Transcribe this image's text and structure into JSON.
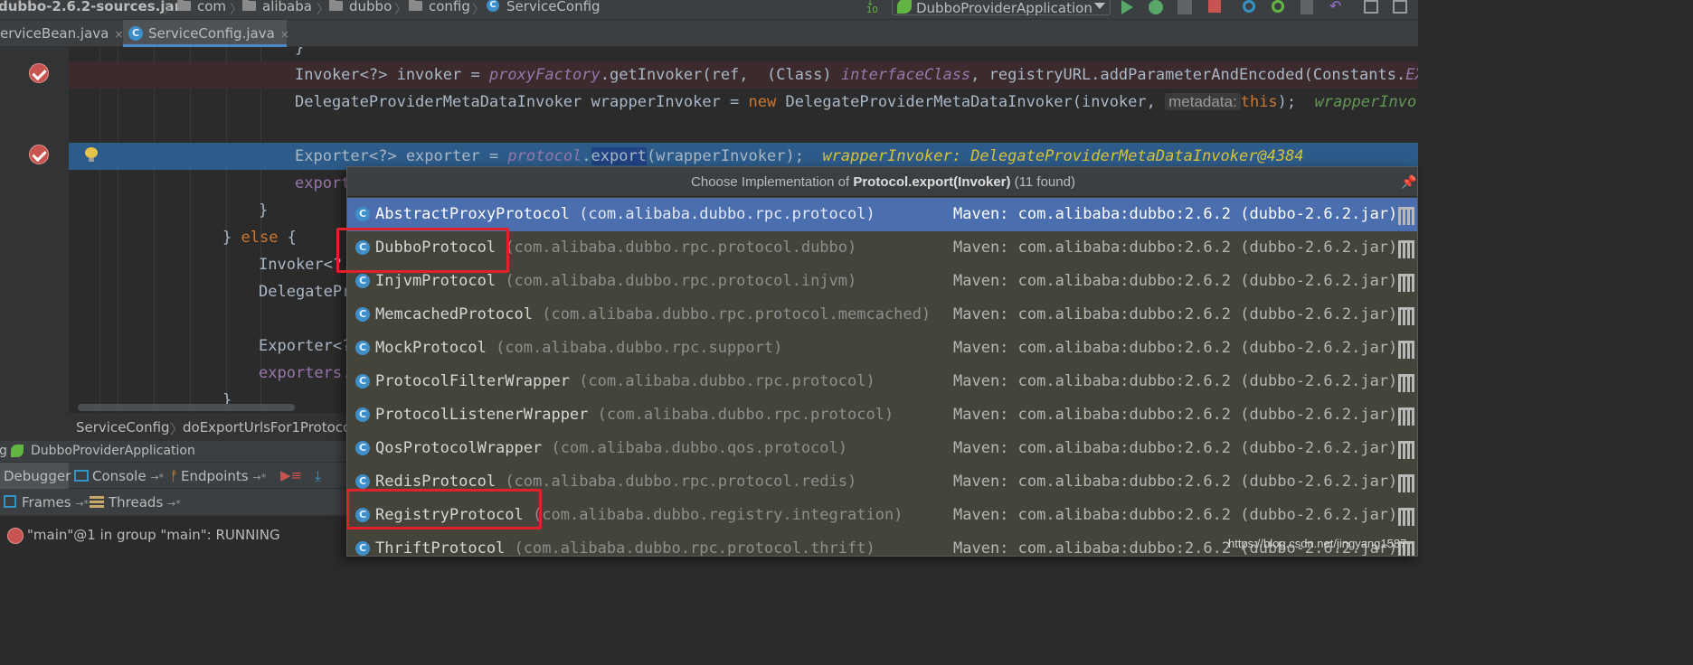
{
  "navbar": {
    "breadcrumbs": [
      "dubbo-2.6.2-sources.jar",
      "com",
      "alibaba",
      "dubbo",
      "config",
      "ServiceConfig"
    ],
    "run_config": "DubboProviderApplication"
  },
  "tabs": [
    {
      "label": "erviceBean.java",
      "close": "×"
    },
    {
      "label": "ServiceConfig.java",
      "close": "×"
    }
  ],
  "editor": {
    "line_top_fragment": "}",
    "line1": {
      "a": "Invoker<?> invoker = ",
      "b": "proxyFactory",
      "c": ".getInvoker(ref,  (Class) ",
      "d": "interfaceClass",
      "e": ", registryURL.addParameterAndEncoded(Constants.",
      "f": "EXPOR"
    },
    "line2": {
      "a": "DelegateProviderMetaDataInvoker wrapperInvoker = ",
      "kw": "new",
      "b": " DelegateProviderMetaDataInvoker(invoker, ",
      "param": "metadata:",
      "kw2": "this",
      "c": ");  ",
      "ghost": "wrapperInvo"
    },
    "line3": {
      "a": "Exporter<?> exporter = ",
      "b": "protocol",
      "dot": ".",
      "sel": "export",
      "c": "(wrapperInvoker);  ",
      "hint": "wrapperInvoker: DelegateProviderMetaDataInvoker@4384"
    },
    "line4": "export",
    "line5": "}",
    "line6": {
      "a": "} ",
      "kw": "else",
      "b": " {"
    },
    "line7": "Invoker<?",
    "line8": "DelegatePr",
    "line9": "Exporter<?",
    "line10": "exporters.",
    "line11": "}"
  },
  "breadcrumb": [
    "ServiceConfig",
    "doExportUrlsFor1Protoco"
  ],
  "debug": {
    "header_prefix": "g",
    "header_title": "DubboProviderApplication",
    "tabs": [
      "Debugger",
      "Console",
      "Endpoints"
    ],
    "tab_arrow": "→*",
    "frames_label": "Frames",
    "threads_label": "Threads",
    "thread_status": "\"main\"@1 in group \"main\": RUNNING"
  },
  "popup": {
    "title_prefix": "Choose Implementation of ",
    "title_method": "Protocol.export(Invoker)",
    "title_suffix": " (11 found)",
    "items": [
      {
        "name": "AbstractProxyProtocol",
        "pkg": "(com.alibaba.dubbo.rpc.protocol)",
        "source": "Maven: com.alibaba:dubbo:2.6.2 (dubbo-2.6.2.jar)"
      },
      {
        "name": "DubboProtocol",
        "pkg": "(com.alibaba.dubbo.rpc.protocol.dubbo)",
        "source": "Maven: com.alibaba:dubbo:2.6.2 (dubbo-2.6.2.jar)"
      },
      {
        "name": "InjvmProtocol",
        "pkg": "(com.alibaba.dubbo.rpc.protocol.injvm)",
        "source": "Maven: com.alibaba:dubbo:2.6.2 (dubbo-2.6.2.jar)"
      },
      {
        "name": "MemcachedProtocol",
        "pkg": "(com.alibaba.dubbo.rpc.protocol.memcached)",
        "source": "Maven: com.alibaba:dubbo:2.6.2 (dubbo-2.6.2.jar)"
      },
      {
        "name": "MockProtocol",
        "pkg": "(com.alibaba.dubbo.rpc.support)",
        "source": "Maven: com.alibaba:dubbo:2.6.2 (dubbo-2.6.2.jar)"
      },
      {
        "name": "ProtocolFilterWrapper",
        "pkg": "(com.alibaba.dubbo.rpc.protocol)",
        "source": "Maven: com.alibaba:dubbo:2.6.2 (dubbo-2.6.2.jar)"
      },
      {
        "name": "ProtocolListenerWrapper",
        "pkg": "(com.alibaba.dubbo.rpc.protocol)",
        "source": "Maven: com.alibaba:dubbo:2.6.2 (dubbo-2.6.2.jar)"
      },
      {
        "name": "QosProtocolWrapper",
        "pkg": "(com.alibaba.dubbo.qos.protocol)",
        "source": "Maven: com.alibaba:dubbo:2.6.2 (dubbo-2.6.2.jar)"
      },
      {
        "name": "RedisProtocol",
        "pkg": "(com.alibaba.dubbo.rpc.protocol.redis)",
        "source": "Maven: com.alibaba:dubbo:2.6.2 (dubbo-2.6.2.jar)"
      },
      {
        "name": "RegistryProtocol",
        "pkg": "(com.alibaba.dubbo.registry.integration)",
        "source": "Maven: com.alibaba:dubbo:2.6.2 (dubbo-2.6.2.jar)"
      },
      {
        "name": "ThriftProtocol",
        "pkg": "(com.alibaba.dubbo.rpc.protocol.thrift)",
        "source": "Maven: com.alibaba:dubbo:2.6.2 (dubbo-2.6.2.jar)"
      }
    ]
  },
  "watermark": "https://blog.csdn.net/jingyang1587",
  "colors": {
    "selection": "#4b6eaf",
    "highlight_box": "#e0202a",
    "breakpoint": "#c75450"
  }
}
